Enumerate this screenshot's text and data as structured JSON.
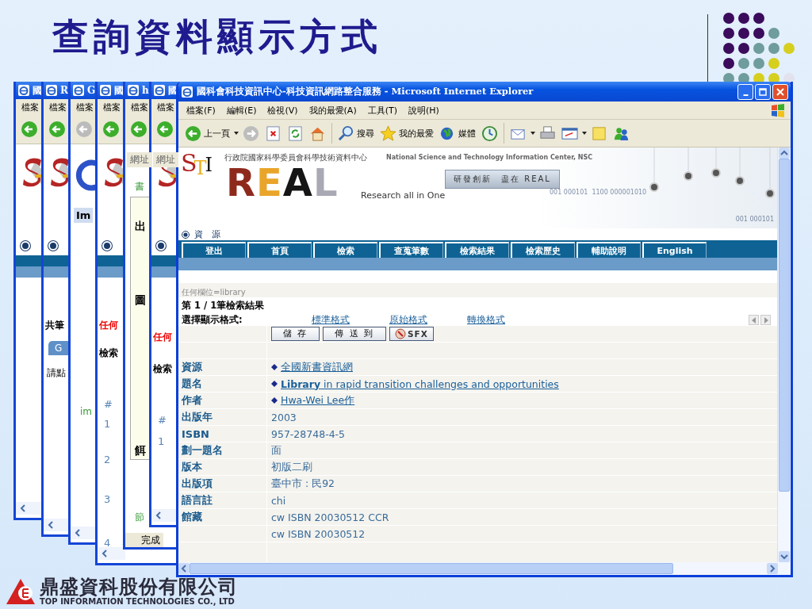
{
  "slide_title": "查詢資料顯示方式",
  "dots": [
    [
      {
        "color": "#3b0b5c"
      },
      {
        "color": "#3b0b5c"
      },
      {
        "color": "#3b0b5c"
      }
    ],
    [
      {
        "color": "#3b0b5c"
      },
      {
        "color": "#3b0b5c"
      },
      {
        "color": "#3b0b5c"
      },
      {
        "color": "#6f9c9c"
      }
    ],
    [
      {
        "color": "#3b0b5c"
      },
      {
        "color": "#3b0b5c"
      },
      {
        "color": "#6f9c9c"
      },
      {
        "color": "#6f9c9c"
      },
      {
        "color": "#d6cf1e"
      }
    ],
    [
      {
        "color": "#3b0b5c"
      },
      {
        "color": "#6f9c9c"
      },
      {
        "color": "#6f9c9c"
      },
      {
        "color": "#d6cf1e"
      }
    ],
    [
      {
        "color": "#6f9c9c"
      },
      {
        "color": "#6f9c9c"
      },
      {
        "color": "#d6cf1e"
      },
      {
        "color": "#d6cf1e"
      },
      {
        "color": "#e2e2ee"
      }
    ]
  ],
  "back_windows": [
    {
      "title": "國",
      "menu": "檔案",
      "kind": "s_logo"
    },
    {
      "title": "R",
      "menu": "檔案",
      "kind": "s_logo",
      "items": [
        {
          "kind": "bold",
          "text": "共筆"
        },
        {
          "kind": "tab",
          "text": "G"
        },
        {
          "kind": "plain",
          "text": "請點"
        }
      ]
    },
    {
      "title": "G",
      "menu": "檔案",
      "kind": "g_logo",
      "items": [
        {
          "kind": "label",
          "text": "Im"
        },
        {
          "kind": "green",
          "text": "im"
        }
      ]
    },
    {
      "title": "國",
      "menu": "檔案",
      "kind": "s_logo",
      "items": [
        {
          "kind": "red",
          "text": "任何"
        },
        {
          "kind": "bold",
          "text": "檢索"
        },
        {
          "kind": "blue",
          "text": "#"
        },
        {
          "kind": "blue",
          "text": "1"
        },
        {
          "kind": "blue",
          "text": "2"
        },
        {
          "kind": "blue",
          "text": "3"
        },
        {
          "kind": "blue",
          "text": "4"
        }
      ]
    },
    {
      "title": "h",
      "menu": "檔案",
      "kind": "table",
      "items": [
        {
          "kind": "address",
          "text": "網址"
        },
        {
          "kind": "green",
          "text": "書"
        },
        {
          "kind": "serif",
          "text": "出"
        },
        {
          "kind": "serif",
          "text": "圖"
        },
        {
          "kind": "serif",
          "text": "餌"
        },
        {
          "kind": "green",
          "text": "節"
        },
        {
          "kind": "status",
          "text": "完成"
        }
      ]
    },
    {
      "title": "國",
      "menu": "檔案",
      "kind": "s_logo",
      "items": [
        {
          "kind": "address",
          "text": "網址"
        },
        {
          "kind": "red",
          "text": "任何"
        },
        {
          "kind": "bold",
          "text": "檢索"
        },
        {
          "kind": "blue",
          "text": "#"
        },
        {
          "kind": "blue",
          "text": "1"
        }
      ]
    }
  ],
  "window": {
    "title": "國科會科技資訊中心-科技資訊網路整合服務 - Microsoft Internet Explorer"
  },
  "menu": [
    "檔案(F)",
    "編輯(E)",
    "檢視(V)",
    "我的最愛(A)",
    "工具(T)",
    "說明(H)"
  ],
  "toolbar": [
    {
      "kind": "back",
      "label": "上一頁"
    },
    {
      "kind": "forward"
    },
    {
      "kind": "stop"
    },
    {
      "kind": "refresh"
    },
    {
      "kind": "home"
    },
    {
      "kind": "search",
      "label": "搜尋"
    },
    {
      "kind": "favorites",
      "label": "我的最愛"
    },
    {
      "kind": "media",
      "label": "媒體"
    },
    {
      "kind": "history"
    },
    {
      "kind": "mail"
    },
    {
      "kind": "print"
    },
    {
      "kind": "edit"
    },
    {
      "kind": "note"
    },
    {
      "kind": "messenger"
    }
  ],
  "banner": {
    "logo_letters": [
      {
        "text": "S",
        "color": "#b22222"
      },
      {
        "text": "T",
        "color": "#e8b020"
      },
      {
        "text": "I",
        "color": "#111111"
      }
    ],
    "brand_letters": [
      {
        "text": "R",
        "color": "#8e2a1c"
      },
      {
        "text": "E",
        "color": "#e9a52a"
      },
      {
        "text": "A",
        "color": "#151515"
      },
      {
        "text": "L",
        "color": "#a9a9b4"
      }
    ],
    "org_zh": "行政院國家科學委員會科學技術資料中心",
    "org_en": "National Science and Technology Information Center, NSC",
    "slogan": "研發創新　盡在 REAL",
    "tagline": "Research all in One",
    "binary_1": "001 000101  1100 000001010",
    "binary_2": "001 000101"
  },
  "section": "資　源",
  "nav": [
    "登出",
    "首頁",
    "檢索",
    "查蒐筆數",
    "檢索結果",
    "檢索歷史",
    "輔助說明",
    "English"
  ],
  "query": "任何欄位=library",
  "result_count": "第 1 / 1筆檢索結果",
  "format_label": "選擇顯示格式:",
  "formats": [
    "標準格式",
    "原始格式",
    "轉換格式"
  ],
  "actions": [
    {
      "kind": "text",
      "label": "儲 存"
    },
    {
      "kind": "text",
      "label": "傳 送 到"
    },
    {
      "kind": "sfx",
      "label": "SFX"
    }
  ],
  "record": [
    {
      "label": "資源",
      "kind": "link",
      "value": "全國新書資訊網"
    },
    {
      "label": "題名",
      "kind": "link",
      "value": "**Library** in rapid transition challenges and opportunities"
    },
    {
      "label": "作者",
      "kind": "link",
      "value": "Hwa-Wei Lee作"
    },
    {
      "label": "出版年",
      "kind": "plain",
      "value": "2003"
    },
    {
      "label": "ISBN",
      "kind": "plain",
      "value": "957-28748-4-5"
    },
    {
      "label": "劃一題名",
      "kind": "plain",
      "value": "面"
    },
    {
      "label": "版本",
      "kind": "plain",
      "value": "初版二刷"
    },
    {
      "label": "出版項",
      "kind": "plain",
      "value": "臺中市 : 民92"
    },
    {
      "label": "語言註",
      "kind": "plain",
      "value": "chi"
    },
    {
      "label": "館藏",
      "kind": "plain",
      "value": "cw ISBN 20030512 CCR"
    },
    {
      "kind": "plain",
      "value": "cw ISBN 20030512"
    }
  ],
  "company": {
    "name_zh": "鼎盛資科股份有限公司",
    "name_en": "TOP INFORMATION TECHNOLOGIES CO., LTD"
  }
}
